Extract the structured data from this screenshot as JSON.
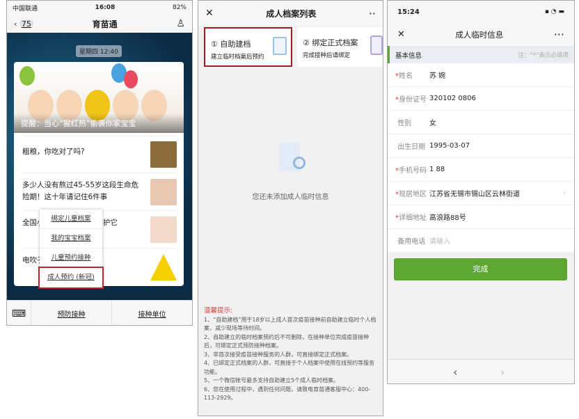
{
  "panel1": {
    "status": {
      "carrier": "中国联通",
      "time": "16:08",
      "battery": "82%"
    },
    "nav": {
      "back_count": "75",
      "title": "育苗通"
    },
    "date": "星期四 12:40",
    "hero_caption": "提醒：当心“猩红热”偷袭你家宝宝",
    "articles": [
      "粗粮，你吃对了吗?",
      "多少人没有熬过45-55岁这段生命危险期！这十年请记住6件事",
      "全国小伙“最沉默的意”爱护它",
      "电吹子不能用?"
    ],
    "menu": [
      "绑定儿童档案",
      "我的宝宝档案",
      "儿童预约接种",
      "成人预约 (新冠)"
    ],
    "bottom": [
      "预防接种",
      "接种单位"
    ]
  },
  "panel2": {
    "title": "成人档案列表",
    "cards": [
      {
        "title": "① 自助建档",
        "subtitle": "建立临时档案后预约"
      },
      {
        "title": "② 绑定正式档案",
        "subtitle": "完成接种后请绑定"
      }
    ],
    "empty_text": "您还未添加成人临时信息",
    "tips_title": "温馨提示:",
    "tips": [
      "1、“自助建档”用于18岁以上成人首次疫苗接种前自助建立临时个人档案，减少现场等待时间。",
      "2、自助建立的临时档案预约后不可删除，在接种单位完成疫苗接种后，可绑定正式预防接种档案。",
      "3、非首次接受疫苗接种服务的人群，可直接绑定正式档案。",
      "4、已绑定正式档案的人群，可直接于个人档案中使用在线预约等服务功能。",
      "5、一个微信帐号最多支持自助建立5个成人临时档案。",
      "6、您在使用过程中，遇到任何问题，请致电育苗通客服中心：400-113-2929。"
    ]
  },
  "panel3": {
    "time": "15:24",
    "title": "成人临时信息",
    "section": "基本信息",
    "note": "注：“*”表示必填项",
    "fields": [
      {
        "label": "姓名",
        "value": "苏 婉",
        "req": true
      },
      {
        "label": "身份证号",
        "value": "320102        0806",
        "req": true
      },
      {
        "label": "性别",
        "value": "女",
        "req": false
      },
      {
        "label": "出生日期",
        "value": "1995-03-07",
        "req": false
      },
      {
        "label": "手机号码",
        "value": "1         88",
        "req": true
      },
      {
        "label": "现居地区",
        "value": "江苏省无锡市锡山区云林街道",
        "req": true
      },
      {
        "label": "详细地址",
        "value": "高浪路88号",
        "req": true
      },
      {
        "label": "备用电话",
        "value": "",
        "placeholder": "请输入",
        "req": false
      }
    ],
    "submit": "完成"
  },
  "colors": {
    "green": "#5ea632",
    "highlight": "#c0242a",
    "tip_red": "#d0443c"
  }
}
